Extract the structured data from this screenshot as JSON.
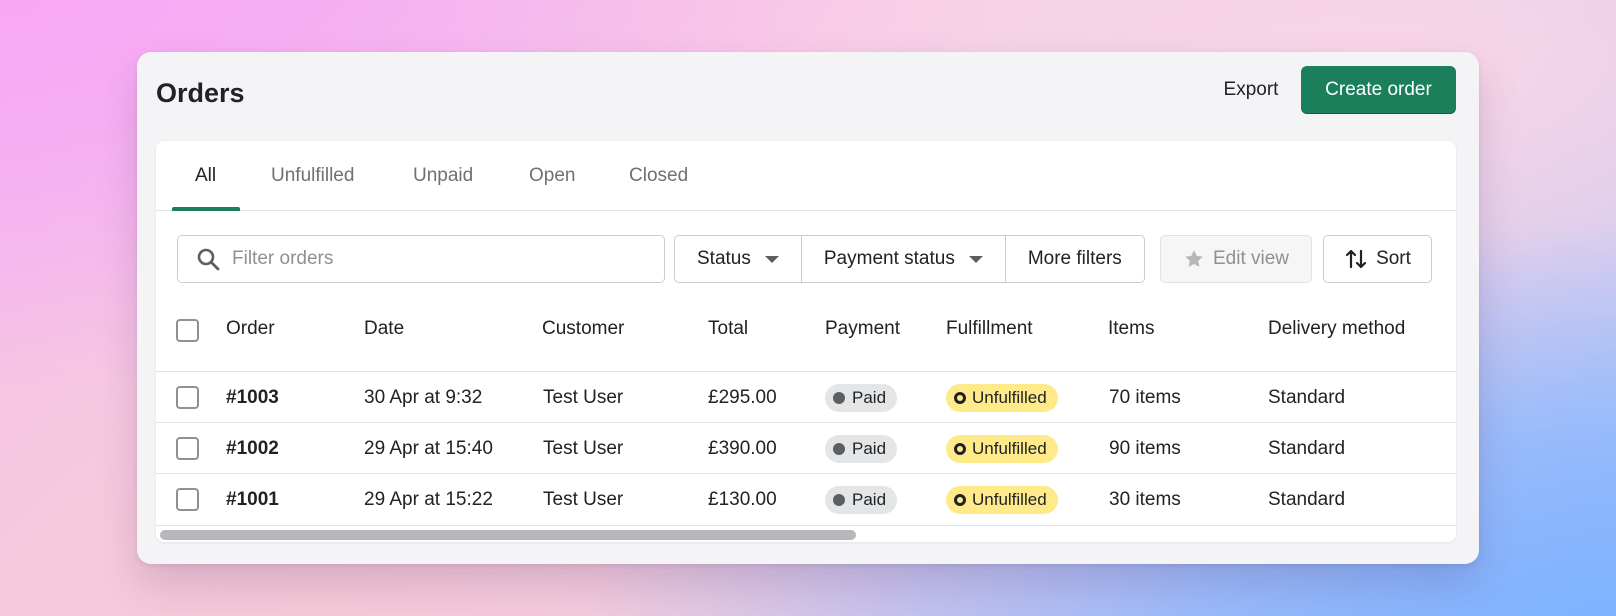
{
  "header": {
    "title": "Orders",
    "export_label": "Export",
    "create_label": "Create order"
  },
  "tabs": [
    {
      "label": "All",
      "active": true
    },
    {
      "label": "Unfulfilled",
      "active": false
    },
    {
      "label": "Unpaid",
      "active": false
    },
    {
      "label": "Open",
      "active": false
    },
    {
      "label": "Closed",
      "active": false
    }
  ],
  "toolbar": {
    "search_placeholder": "Filter orders",
    "status_label": "Status",
    "payment_status_label": "Payment status",
    "more_filters_label": "More filters",
    "edit_view_label": "Edit view",
    "sort_label": "Sort"
  },
  "table": {
    "columns": [
      "Order",
      "Date",
      "Customer",
      "Total",
      "Payment",
      "Fulfillment",
      "Items",
      "Delivery method"
    ],
    "rows": [
      {
        "order": "#1003",
        "date": "30 Apr at 9:32",
        "customer": "Test User",
        "total": "£295.00",
        "payment": "Paid",
        "fulfillment": "Unfulfilled",
        "items": "70 items",
        "delivery": "Standard"
      },
      {
        "order": "#1002",
        "date": "29 Apr at 15:40",
        "customer": "Test User",
        "total": "£390.00",
        "payment": "Paid",
        "fulfillment": "Unfulfilled",
        "items": "90 items",
        "delivery": "Standard"
      },
      {
        "order": "#1001",
        "date": "29 Apr at 15:22",
        "customer": "Test User",
        "total": "£130.00",
        "payment": "Paid",
        "fulfillment": "Unfulfilled",
        "items": "30 items",
        "delivery": "Standard"
      }
    ]
  },
  "colors": {
    "primary": "#1a7f5a",
    "paid_badge": "#e4e5e7",
    "unfulfilled_badge": "#ffea8a"
  },
  "icons": {
    "search": "search-icon",
    "edit_view": "star-icon",
    "sort": "sort-arrows-icon"
  }
}
